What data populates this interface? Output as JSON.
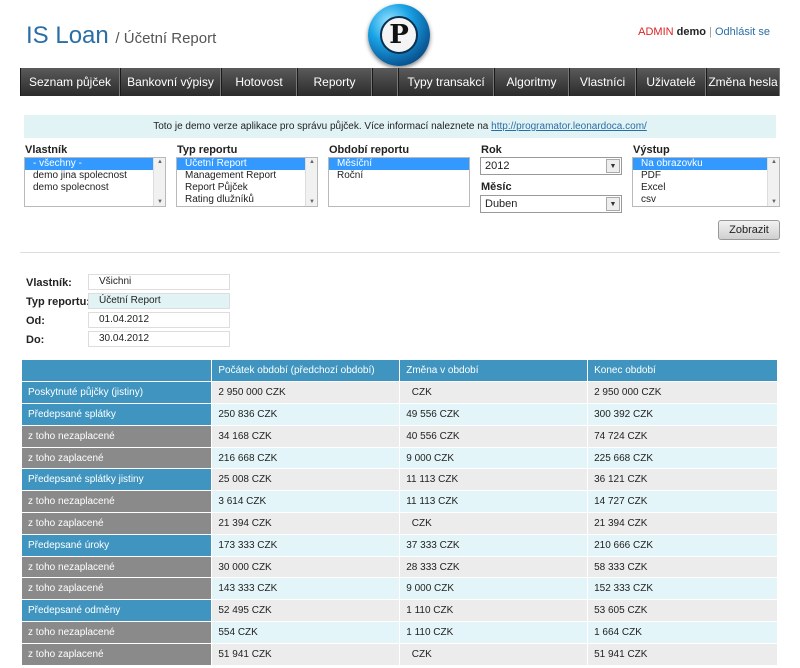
{
  "header": {
    "app_name": "IS Loan",
    "page_title": "/ Účetní Report",
    "logo_letter": "P",
    "role": "ADMIN",
    "user": "demo",
    "separator": "|",
    "logout": "Odhlásit se"
  },
  "nav": {
    "items": [
      {
        "label": "Seznam půjček"
      },
      {
        "label": "Bankovní výpisy"
      },
      {
        "label": "Hotovost"
      },
      {
        "label": "Reporty"
      },
      {
        "label": ""
      },
      {
        "label": "Typy transakcí"
      },
      {
        "label": "Algoritmy"
      },
      {
        "label": "Vlastníci"
      },
      {
        "label": "Uživatelé"
      },
      {
        "label": "Změna hesla"
      }
    ]
  },
  "demo_info": {
    "text": "Toto je demo verze aplikace pro správu půjček. Více informací naleznete na",
    "link": "http://programator.leonardoca.com/"
  },
  "filters": {
    "owner": {
      "label": "Vlastník",
      "options": [
        "- všechny -",
        "demo jina spolecnost",
        "demo spolecnost"
      ]
    },
    "report_type": {
      "label": "Typ reportu",
      "options": [
        "Účetní Report",
        "Management Report",
        "Report Půjček",
        "Rating dlužníků"
      ]
    },
    "period": {
      "label": "Období reportu",
      "options": [
        "Měsíční",
        "Roční"
      ]
    },
    "year": {
      "label": "Rok",
      "value": "2012"
    },
    "month": {
      "label": "Měsíc",
      "value": "Duben"
    },
    "output": {
      "label": "Výstup",
      "options": [
        "Na obrazovku",
        "PDF",
        "Excel",
        "csv"
      ]
    },
    "submit": "Zobrazit"
  },
  "meta": {
    "owner_label": "Vlastník:",
    "owner_value": "Všichni",
    "type_label": "Typ reportu:",
    "type_value": "Účetní Report",
    "from_label": "Od:",
    "from_value": "01.04.2012",
    "to_label": "Do:",
    "to_value": "30.04.2012"
  },
  "report": {
    "columns": [
      "",
      "Počátek období (předchozí období)",
      "Změna v období",
      "Konec období"
    ],
    "rows": [
      {
        "label": "Poskytnuté půjčky (jistiny)",
        "kind": "main",
        "values": [
          "2 950 000 CZK",
          "  CZK",
          "2 950 000 CZK"
        ]
      },
      {
        "label": "Předepsané splátky",
        "kind": "main",
        "values": [
          "250 836 CZK",
          "49 556 CZK",
          "300 392 CZK"
        ]
      },
      {
        "label": "z toho nezaplacené",
        "kind": "sub",
        "values": [
          "34 168 CZK",
          "40 556 CZK",
          "74 724 CZK"
        ]
      },
      {
        "label": "z toho zaplacené",
        "kind": "sub",
        "values": [
          "216 668 CZK",
          "9 000 CZK",
          "225 668 CZK"
        ]
      },
      {
        "label": "Předepsané splátky jistiny",
        "kind": "main",
        "values": [
          "25 008 CZK",
          "11 113 CZK",
          "36 121 CZK"
        ]
      },
      {
        "label": "z toho nezaplacené",
        "kind": "sub",
        "values": [
          "3 614 CZK",
          "11 113 CZK",
          "14 727 CZK"
        ]
      },
      {
        "label": "z toho zaplacené",
        "kind": "sub",
        "values": [
          "21 394 CZK",
          "  CZK",
          "21 394 CZK"
        ]
      },
      {
        "label": "Předepsané úroky",
        "kind": "main",
        "values": [
          "173 333 CZK",
          "37 333 CZK",
          "210 666 CZK"
        ]
      },
      {
        "label": "z toho nezaplacené",
        "kind": "sub",
        "values": [
          "30 000 CZK",
          "28 333 CZK",
          "58 333 CZK"
        ]
      },
      {
        "label": "z toho zaplacené",
        "kind": "sub",
        "values": [
          "143 333 CZK",
          "9 000 CZK",
          "152 333 CZK"
        ]
      },
      {
        "label": "Předepsané odměny",
        "kind": "main",
        "values": [
          "52 495 CZK",
          "1 110 CZK",
          "53 605 CZK"
        ]
      },
      {
        "label": "z toho nezaplacené",
        "kind": "sub",
        "values": [
          "554 CZK",
          "1 110 CZK",
          "1 664 CZK"
        ]
      },
      {
        "label": "z toho zaplacené",
        "kind": "sub",
        "values": [
          "51 941 CZK",
          "  CZK",
          "51 941 CZK"
        ]
      }
    ]
  }
}
